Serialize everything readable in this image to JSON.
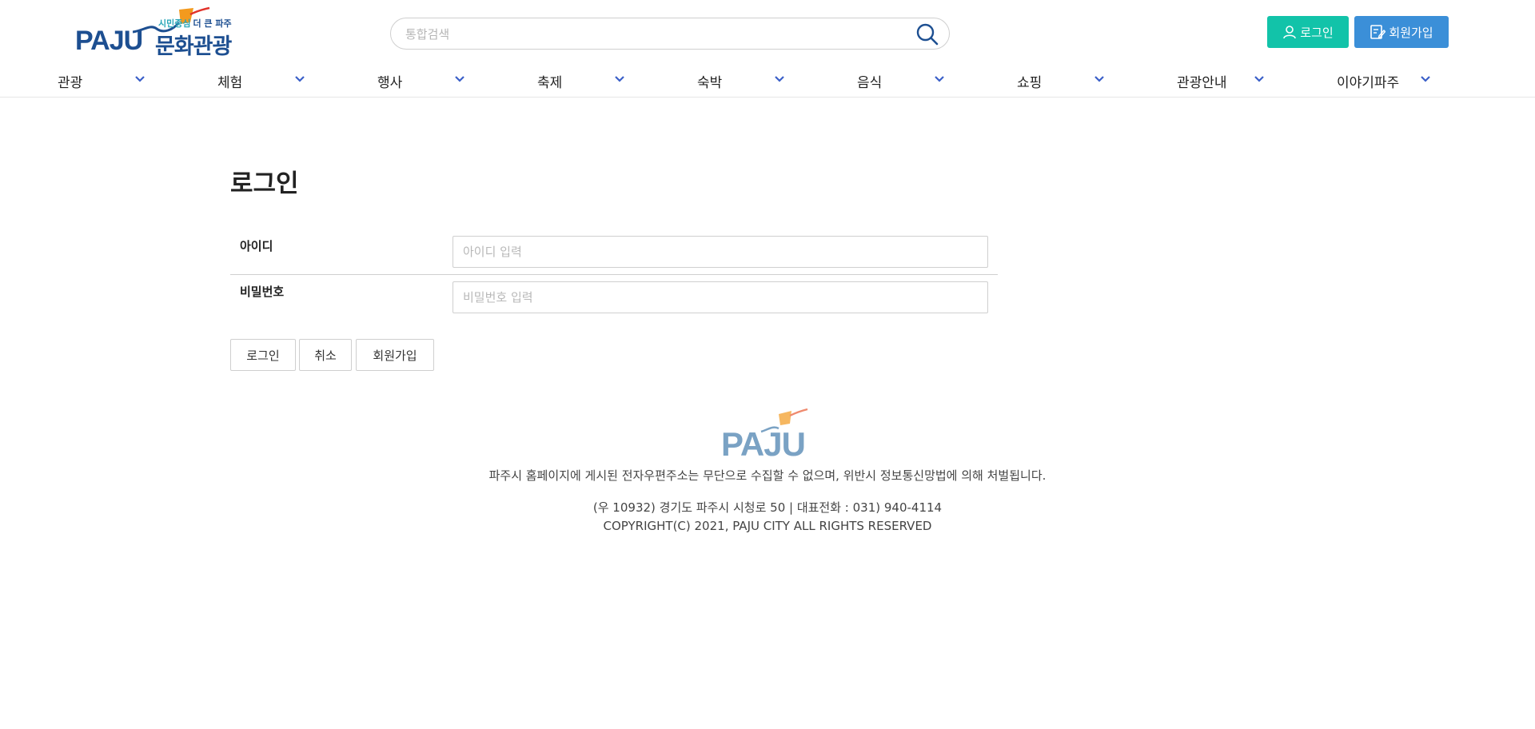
{
  "header": {
    "logo": {
      "brand": "PAJU",
      "slogan_part1": "시민중심",
      "slogan_part2": "더 큰 파주",
      "title": "문화관광"
    },
    "search": {
      "placeholder": "통합검색",
      "icon": "search-icon"
    },
    "login_label": "로그인",
    "join_label": "회원가입",
    "login_icon": "user-icon",
    "join_icon": "edit-form-icon"
  },
  "nav": {
    "items": [
      {
        "label": "관광"
      },
      {
        "label": "체험"
      },
      {
        "label": "행사"
      },
      {
        "label": "축제"
      },
      {
        "label": "숙박"
      },
      {
        "label": "음식"
      },
      {
        "label": "쇼핑"
      },
      {
        "label": "관광안내"
      },
      {
        "label": "이야기파주"
      }
    ],
    "chevron_icon": "chevron-down-icon"
  },
  "main": {
    "title": "로그인",
    "id_label": "아이디",
    "id_placeholder": "아이디 입력",
    "id_value": "",
    "password_label": "비밀번호",
    "password_placeholder": "비밀번호 입력",
    "password_value": "",
    "buttons": {
      "login": "로그인",
      "cancel": "취소",
      "join": "회원가입"
    }
  },
  "footer": {
    "brand": "PAJU",
    "notice": "파주시 홈페이지에 게시된 전자우편주소는 무단으로 수집할 수 없으며, 위반시 정보통신망법에 의해 처벌됩니다.",
    "address": "(우 10932) 경기도 파주시 시청로 50 | 대표전화 : 031) 940-4114",
    "copyright": "COPYRIGHT(C) 2021, PAJU CITY ALL RIGHTS RESERVED"
  },
  "colors": {
    "brand_blue": "#1d4f91",
    "login_button": "#12c3a9",
    "join_button": "#3b8fd8",
    "nav_chevron": "#3a5fc8",
    "kite_orange": "#f39a1e",
    "kite_red": "#e2332b"
  }
}
